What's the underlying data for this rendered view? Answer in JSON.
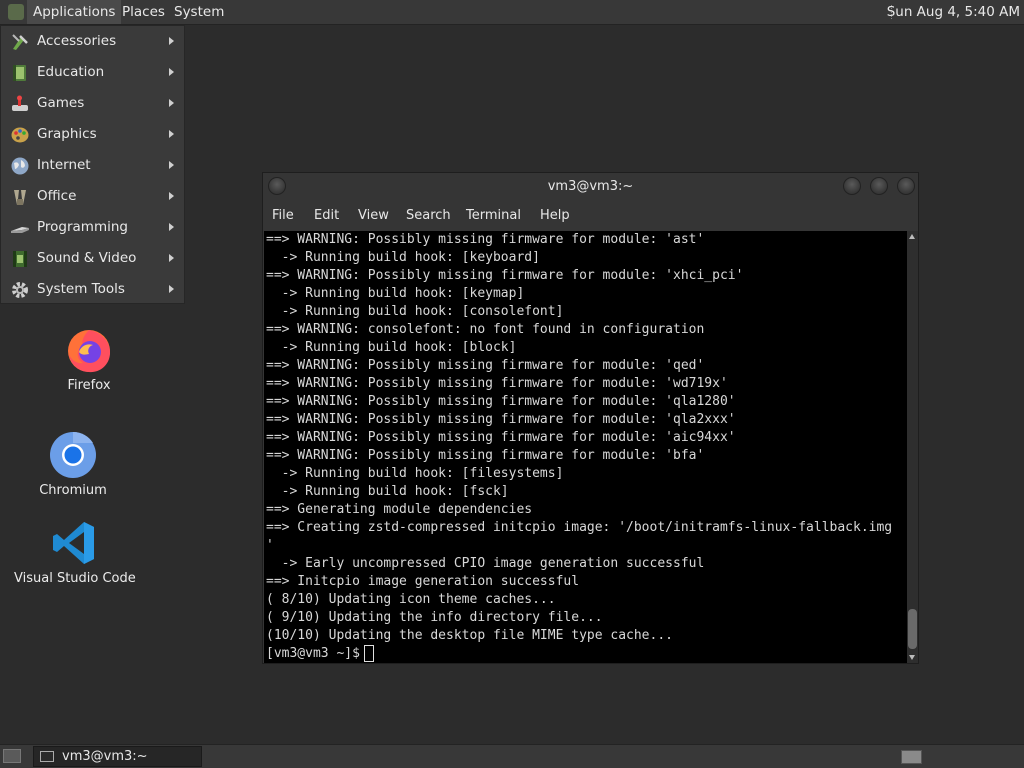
{
  "top_panel": {
    "menus": [
      "Applications",
      "Places",
      "System"
    ],
    "clock": "Sun Aug  4, 5:40 AM"
  },
  "app_menu": {
    "items": [
      {
        "label": "Accessories",
        "icon": "accessories-icon"
      },
      {
        "label": "Education",
        "icon": "education-icon"
      },
      {
        "label": "Games",
        "icon": "games-icon"
      },
      {
        "label": "Graphics",
        "icon": "graphics-icon"
      },
      {
        "label": "Internet",
        "icon": "internet-icon"
      },
      {
        "label": "Office",
        "icon": "office-icon"
      },
      {
        "label": "Programming",
        "icon": "programming-icon"
      },
      {
        "label": "Sound & Video",
        "icon": "sound-video-icon"
      },
      {
        "label": "System Tools",
        "icon": "system-tools-icon"
      }
    ]
  },
  "desktop_icons": [
    {
      "label": "Firefox",
      "icon": "firefox-icon"
    },
    {
      "label": "Chromium",
      "icon": "chromium-icon"
    },
    {
      "label": "Visual Studio Code",
      "icon": "vscode-icon"
    }
  ],
  "terminal": {
    "title": "vm3@vm3:~",
    "menu": [
      "File",
      "Edit",
      "View",
      "Search",
      "Terminal",
      "Help"
    ],
    "lines": [
      "==> WARNING: Possibly missing firmware for module: 'ast'",
      "  -> Running build hook: [keyboard]",
      "==> WARNING: Possibly missing firmware for module: 'xhci_pci'",
      "  -> Running build hook: [keymap]",
      "  -> Running build hook: [consolefont]",
      "==> WARNING: consolefont: no font found in configuration",
      "  -> Running build hook: [block]",
      "==> WARNING: Possibly missing firmware for module: 'qed'",
      "==> WARNING: Possibly missing firmware for module: 'wd719x'",
      "==> WARNING: Possibly missing firmware for module: 'qla1280'",
      "==> WARNING: Possibly missing firmware for module: 'qla2xxx'",
      "==> WARNING: Possibly missing firmware for module: 'aic94xx'",
      "==> WARNING: Possibly missing firmware for module: 'bfa'",
      "  -> Running build hook: [filesystems]",
      "  -> Running build hook: [fsck]",
      "==> Generating module dependencies",
      "==> Creating zstd-compressed initcpio image: '/boot/initramfs-linux-fallback.img",
      "'",
      "  -> Early uncompressed CPIO image generation successful",
      "==> Initcpio image generation successful",
      "( 8/10) Updating icon theme caches...",
      "( 9/10) Updating the info directory file...",
      "(10/10) Updating the desktop file MIME type cache..."
    ],
    "prompt": "[vm3@vm3 ~]$"
  },
  "bottom_panel": {
    "task_label": "vm3@vm3:~"
  },
  "colors": {
    "desktop_bg": "#2c2c2c",
    "panel_bg": "#383838",
    "terminal_bg": "#000000",
    "terminal_fg": "#d8d8d8"
  }
}
